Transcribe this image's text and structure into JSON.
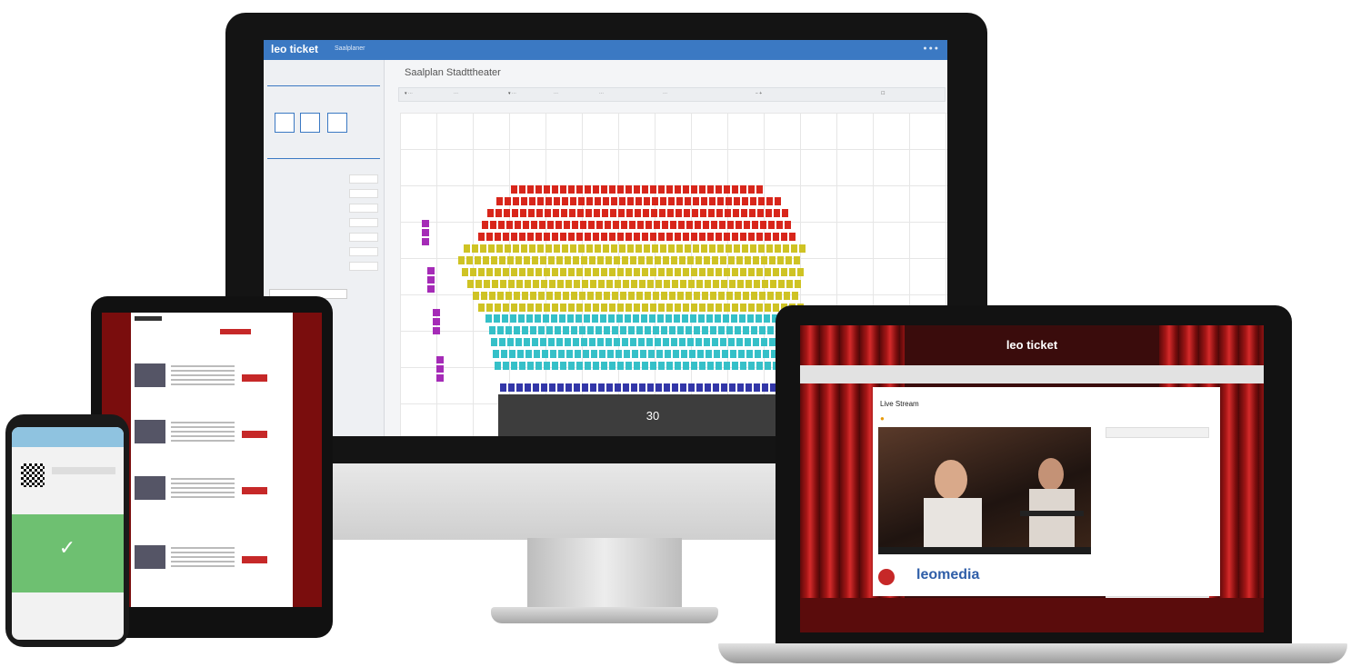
{
  "monitor": {
    "app": {
      "logo": "leo ticket",
      "nav": "Saalplaner",
      "page_title": "Saalplan Stadttheater",
      "stage_label": "30"
    }
  },
  "laptop": {
    "logo": "leo ticket",
    "stream_title": "Live Stream",
    "brand_logo": "leomedia"
  },
  "colors": {
    "app_blue": "#3b79c3",
    "seat_red": "#d8261b",
    "seat_yellow": "#cfc324",
    "seat_cyan": "#35c0c8",
    "seat_blue": "#3337a8",
    "seat_purple": "#a52bb7",
    "curtain_red": "#b81818",
    "success_green": "#6ec071"
  }
}
